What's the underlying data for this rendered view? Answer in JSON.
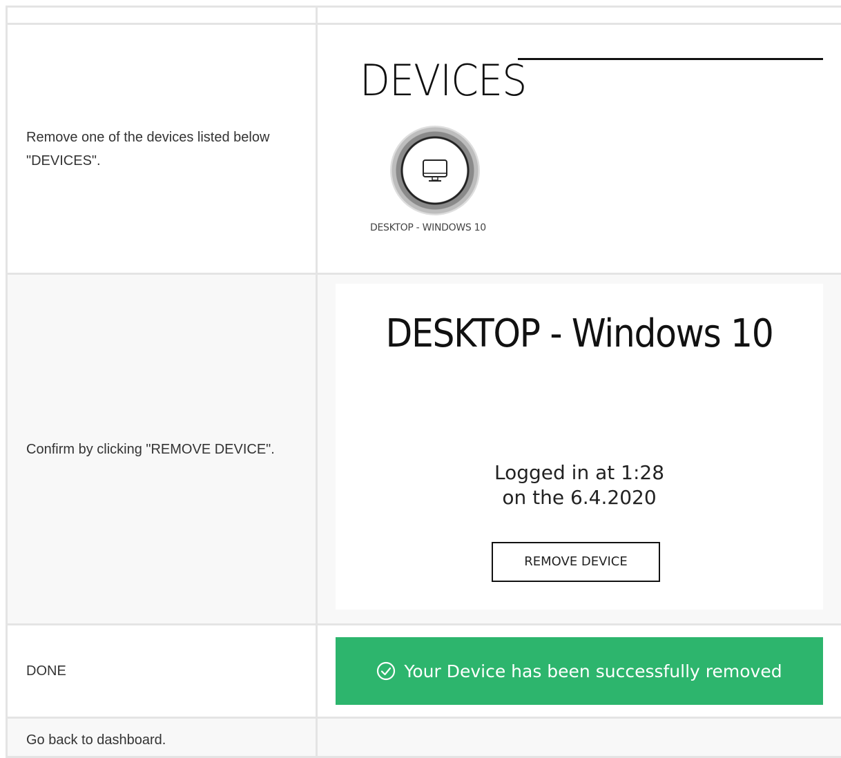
{
  "steps": [
    {
      "text": "Remove one of the devices listed below \"DEVICES\"."
    },
    {
      "text": "Confirm by clicking \"REMOVE DEVICE\"."
    },
    {
      "text": "DONE"
    },
    {
      "text": "Go back to dashboard."
    }
  ],
  "devices_panel": {
    "title": "DEVICES",
    "device_label": "DESKTOP - WINDOWS 10",
    "device_icon": "monitor-icon"
  },
  "confirm_panel": {
    "title": "DESKTOP - Windows 10",
    "logged_line1": "Logged in at 1:28",
    "logged_line2": "on the 6.4.2020",
    "button_label": "REMOVE DEVICE"
  },
  "done_panel": {
    "message": "Your Device has been successfully removed",
    "icon": "check-circle-icon",
    "color": "#2db56d"
  }
}
